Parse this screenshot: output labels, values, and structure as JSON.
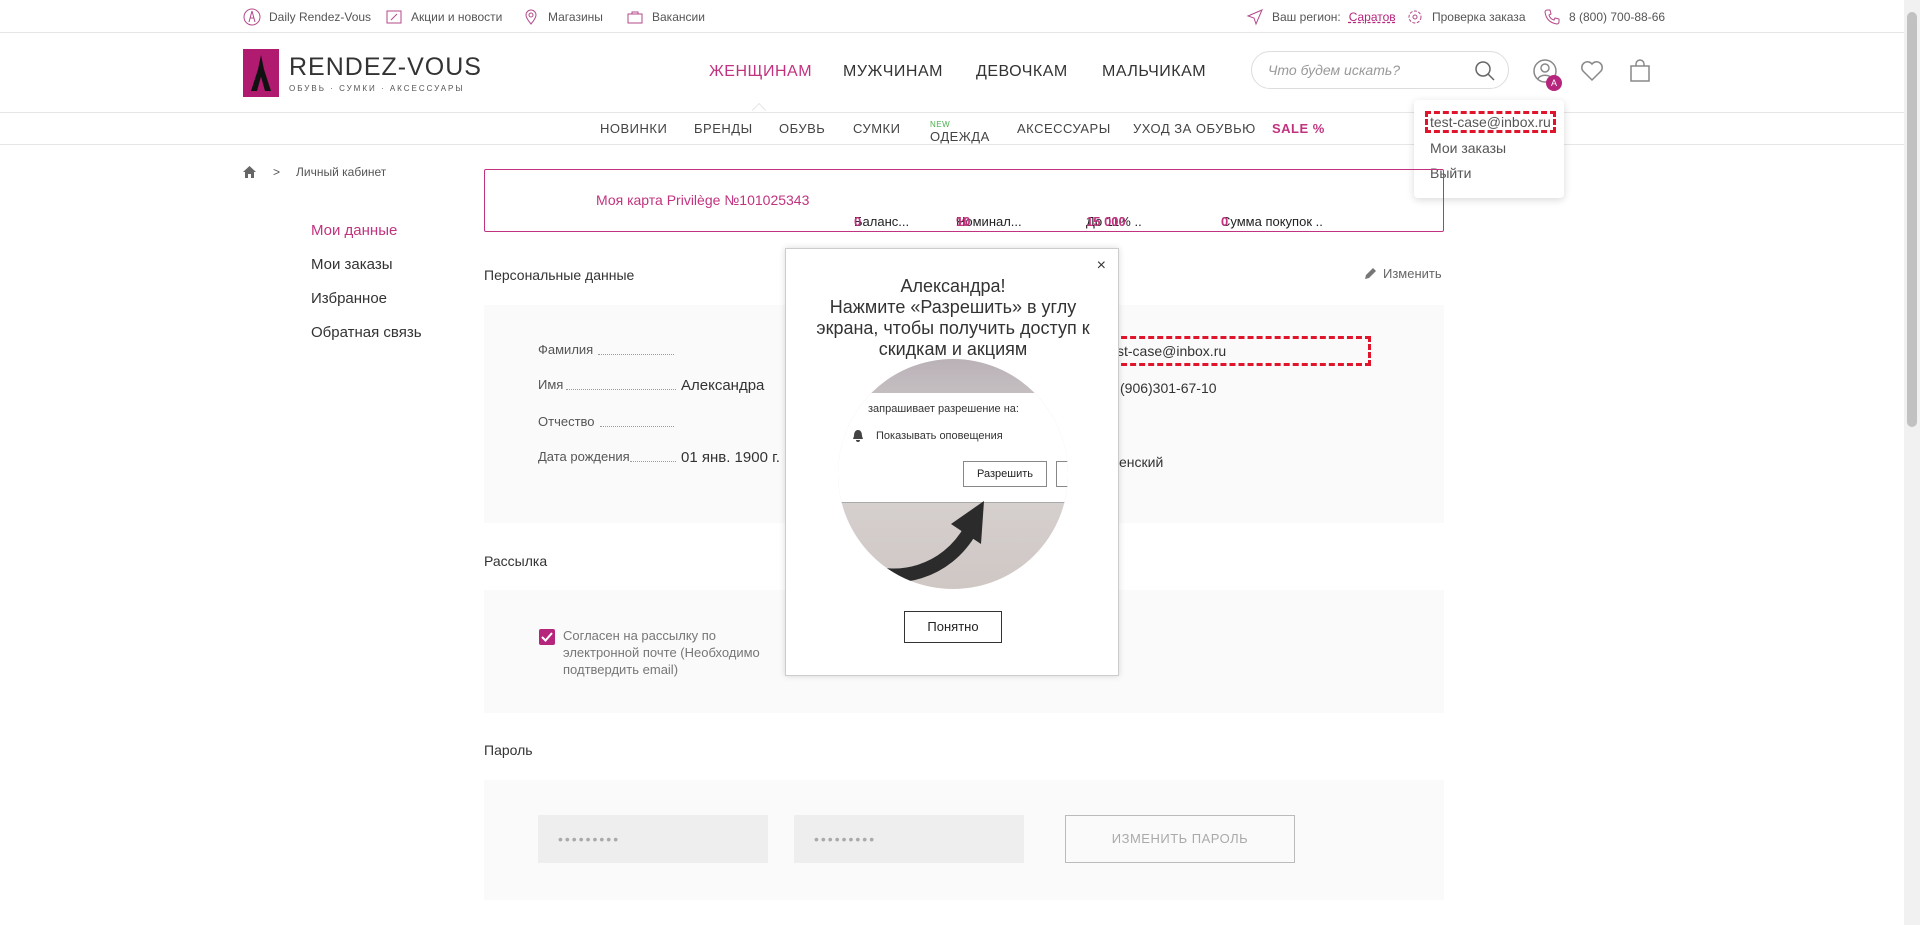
{
  "topbar": {
    "daily": "Daily Rendez-Vous",
    "promos": "Акции и новости",
    "stores": "Магазины",
    "jobs": "Вакансии",
    "region_label": "Ваш регион:",
    "region_value": "Саратов",
    "order_check": "Проверка заказа",
    "phone": "8 (800) 700-88-66"
  },
  "header": {
    "logo_text": "RENDEZ-VOUS",
    "logo_sub": "ОБУВЬ · СУМКИ · АКСЕССУАРЫ",
    "nav": [
      "ЖЕНЩИНАМ",
      "МУЖЧИНАМ",
      "ДЕВОЧКАМ",
      "МАЛЬЧИКАМ"
    ],
    "search_placeholder": "Что будем искать?",
    "avatar_badge": "A"
  },
  "subnav": {
    "items": [
      "НОВИНКИ",
      "БРЕНДЫ",
      "ОБУВЬ",
      "СУМКИ",
      "ОДЕЖДА",
      "АКСЕССУАРЫ",
      "УХОД ЗА ОБУВЬЮ",
      "SALE %"
    ],
    "new_tag": "NEW"
  },
  "account_menu": {
    "email": "test-case@inbox.ru",
    "orders": "Мои заказы",
    "logout": "Выйти"
  },
  "breadcrumb": {
    "sep": ">",
    "current": "Личный кабинет"
  },
  "sidebar": [
    "Мои данные",
    "Мои заказы",
    "Избранное",
    "Обратная связь"
  ],
  "card": {
    "title": "Моя карта Privilège №101025343",
    "balance_label": "Баланс...",
    "balance_value": "0",
    "nominal_label": "Номинал...",
    "nominal_value": "10",
    "nominal_unit": "%",
    "upto_label": "До 11% ..",
    "upto_value": "15 000",
    "sum_label": "Сумма покупок ..",
    "sum_value": "0"
  },
  "personal": {
    "title": "Персональные данные",
    "edit": "Изменить",
    "fields": [
      {
        "label": "Фамилия",
        "value": ""
      },
      {
        "label": "Имя",
        "value": "Александра"
      },
      {
        "label": "Отчество",
        "value": ""
      },
      {
        "label": "Дата рождения",
        "value": "01 янв. 1900 г."
      }
    ],
    "email_partial": "st-case@inbox.ru",
    "phone_partial": "(906)301-67-10",
    "gender_partial": "енский"
  },
  "newsletter": {
    "title": "Рассылка",
    "consent": "Согласен на рассылку по электронной почте (Необходимо подтвердить email)"
  },
  "password": {
    "title": "Пароль",
    "mask1": "•••••••••",
    "mask2": "•••••••••",
    "change": "ИЗМЕНИТЬ ПАРОЛЬ"
  },
  "modal": {
    "close": "×",
    "title": "Александра!\nНажмите «Разрешить» в углу экрана, чтобы получить доступ к скидкам и акциям",
    "perm_request": "запрашивает разрешение на:",
    "perm_notify": "Показывать оповещения",
    "perm_allow": "Разрешить",
    "ok": "Понятно"
  },
  "colors": {
    "accent": "#c2337f",
    "annotation": "#e0142b"
  }
}
